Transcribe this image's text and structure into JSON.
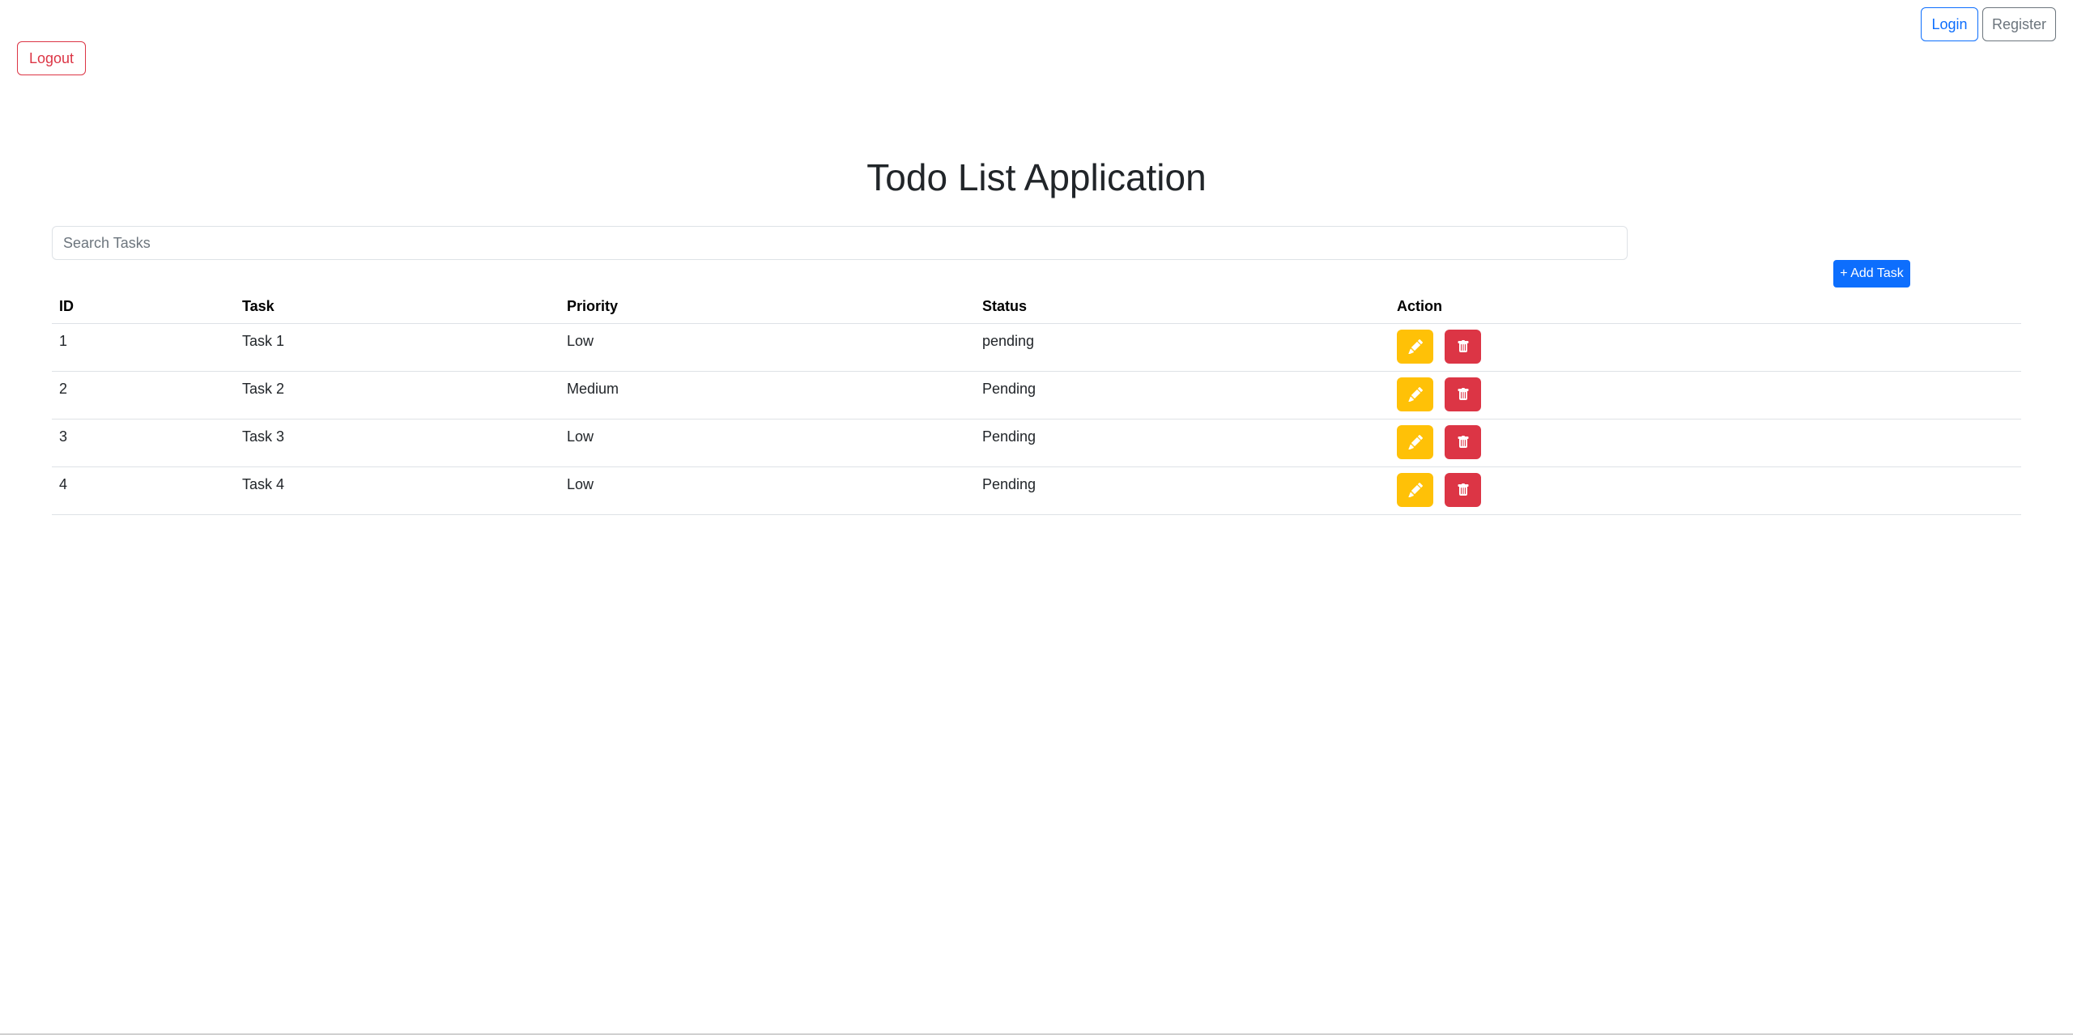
{
  "auth": {
    "login_label": "Login",
    "register_label": "Register",
    "logout_label": "Logout"
  },
  "page": {
    "title": "Todo List Application"
  },
  "search": {
    "placeholder": "Search Tasks",
    "value": ""
  },
  "toolbar": {
    "add_label": "+ Add Task"
  },
  "table": {
    "headers": {
      "id": "ID",
      "task": "Task",
      "priority": "Priority",
      "status": "Status",
      "action": "Action"
    },
    "rows": [
      {
        "id": "1",
        "task": "Task 1",
        "priority": "Low",
        "status": "pending"
      },
      {
        "id": "2",
        "task": "Task 2",
        "priority": "Medium",
        "status": "Pending"
      },
      {
        "id": "3",
        "task": "Task 3",
        "priority": "Low",
        "status": "Pending"
      },
      {
        "id": "4",
        "task": "Task 4",
        "priority": "Low",
        "status": "Pending"
      }
    ]
  },
  "icons": {
    "edit": "pencil-icon",
    "delete": "trash-icon"
  },
  "colors": {
    "primary": "#0d6efd",
    "secondary": "#6c757d",
    "danger": "#dc3545",
    "warning": "#ffc107"
  }
}
